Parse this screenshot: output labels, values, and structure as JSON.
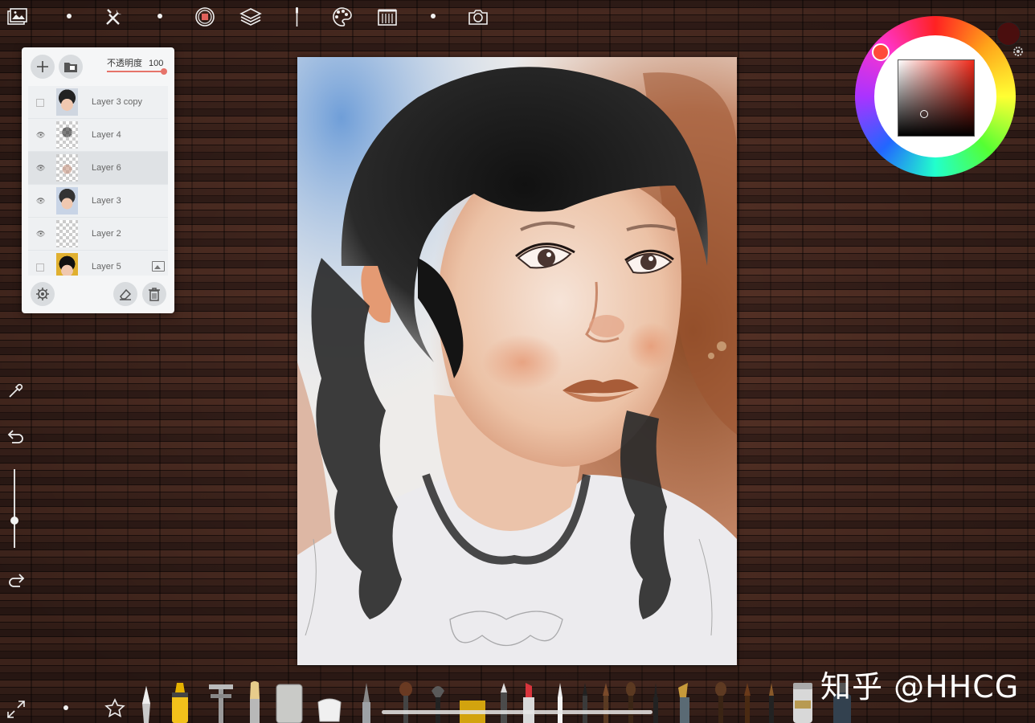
{
  "app": {
    "top_toolbar": [
      {
        "icon": "gallery-icon"
      },
      {
        "icon": "dot-icon"
      },
      {
        "icon": "tools-icon"
      },
      {
        "icon": "dot-icon"
      },
      {
        "icon": "tracing-icon"
      },
      {
        "icon": "layers-icon"
      },
      {
        "icon": "brush-settings-icon"
      },
      {
        "icon": "palette-icon"
      },
      {
        "icon": "paper-texture-icon"
      },
      {
        "icon": "dot-icon"
      },
      {
        "icon": "camera-icon"
      }
    ]
  },
  "layers_panel": {
    "opacity_label": "不透明度",
    "opacity_value": "100",
    "opacity_fraction": 1.0,
    "layers": [
      {
        "name": "Layer 3 copy",
        "visible": false,
        "selected": false
      },
      {
        "name": "Layer 4",
        "visible": true,
        "selected": false
      },
      {
        "name": "Layer 6",
        "visible": true,
        "selected": true
      },
      {
        "name": "Layer 3",
        "visible": true,
        "selected": false
      },
      {
        "name": "Layer 2",
        "visible": true,
        "selected": false
      },
      {
        "name": "Layer 5",
        "visible": false,
        "selected": false,
        "image_layer": true
      }
    ]
  },
  "color": {
    "current": "#4a0e0e",
    "hue": "#f02a1a"
  },
  "left_tools": [
    "eyedropper-icon",
    "undo-icon",
    "brush-size-slider",
    "redo-icon"
  ],
  "bottom_tools": [
    "expand-icon",
    "dot-icon",
    "favorites-star-icon",
    "knife-tool",
    "marker-tool",
    "caliper-tool",
    "flat-brush-tool",
    "eraser-block-tool",
    "sponge-tool",
    "pen-tool",
    "round-brush-tool",
    "fan-brush-tool",
    "sponge-yellow-tool",
    "pencil-tool",
    "lipstick-tool",
    "fine-pen-tool",
    "liner-tool",
    "wash-brush-tool",
    "detail-brush-tool",
    "nib-pen-tool",
    "mop-brush-tool",
    "sable-brush-tool",
    "rigger-brush-tool",
    "salt-tool",
    "ink-bottle-tool"
  ],
  "watermark": "知乎 @HHCG"
}
